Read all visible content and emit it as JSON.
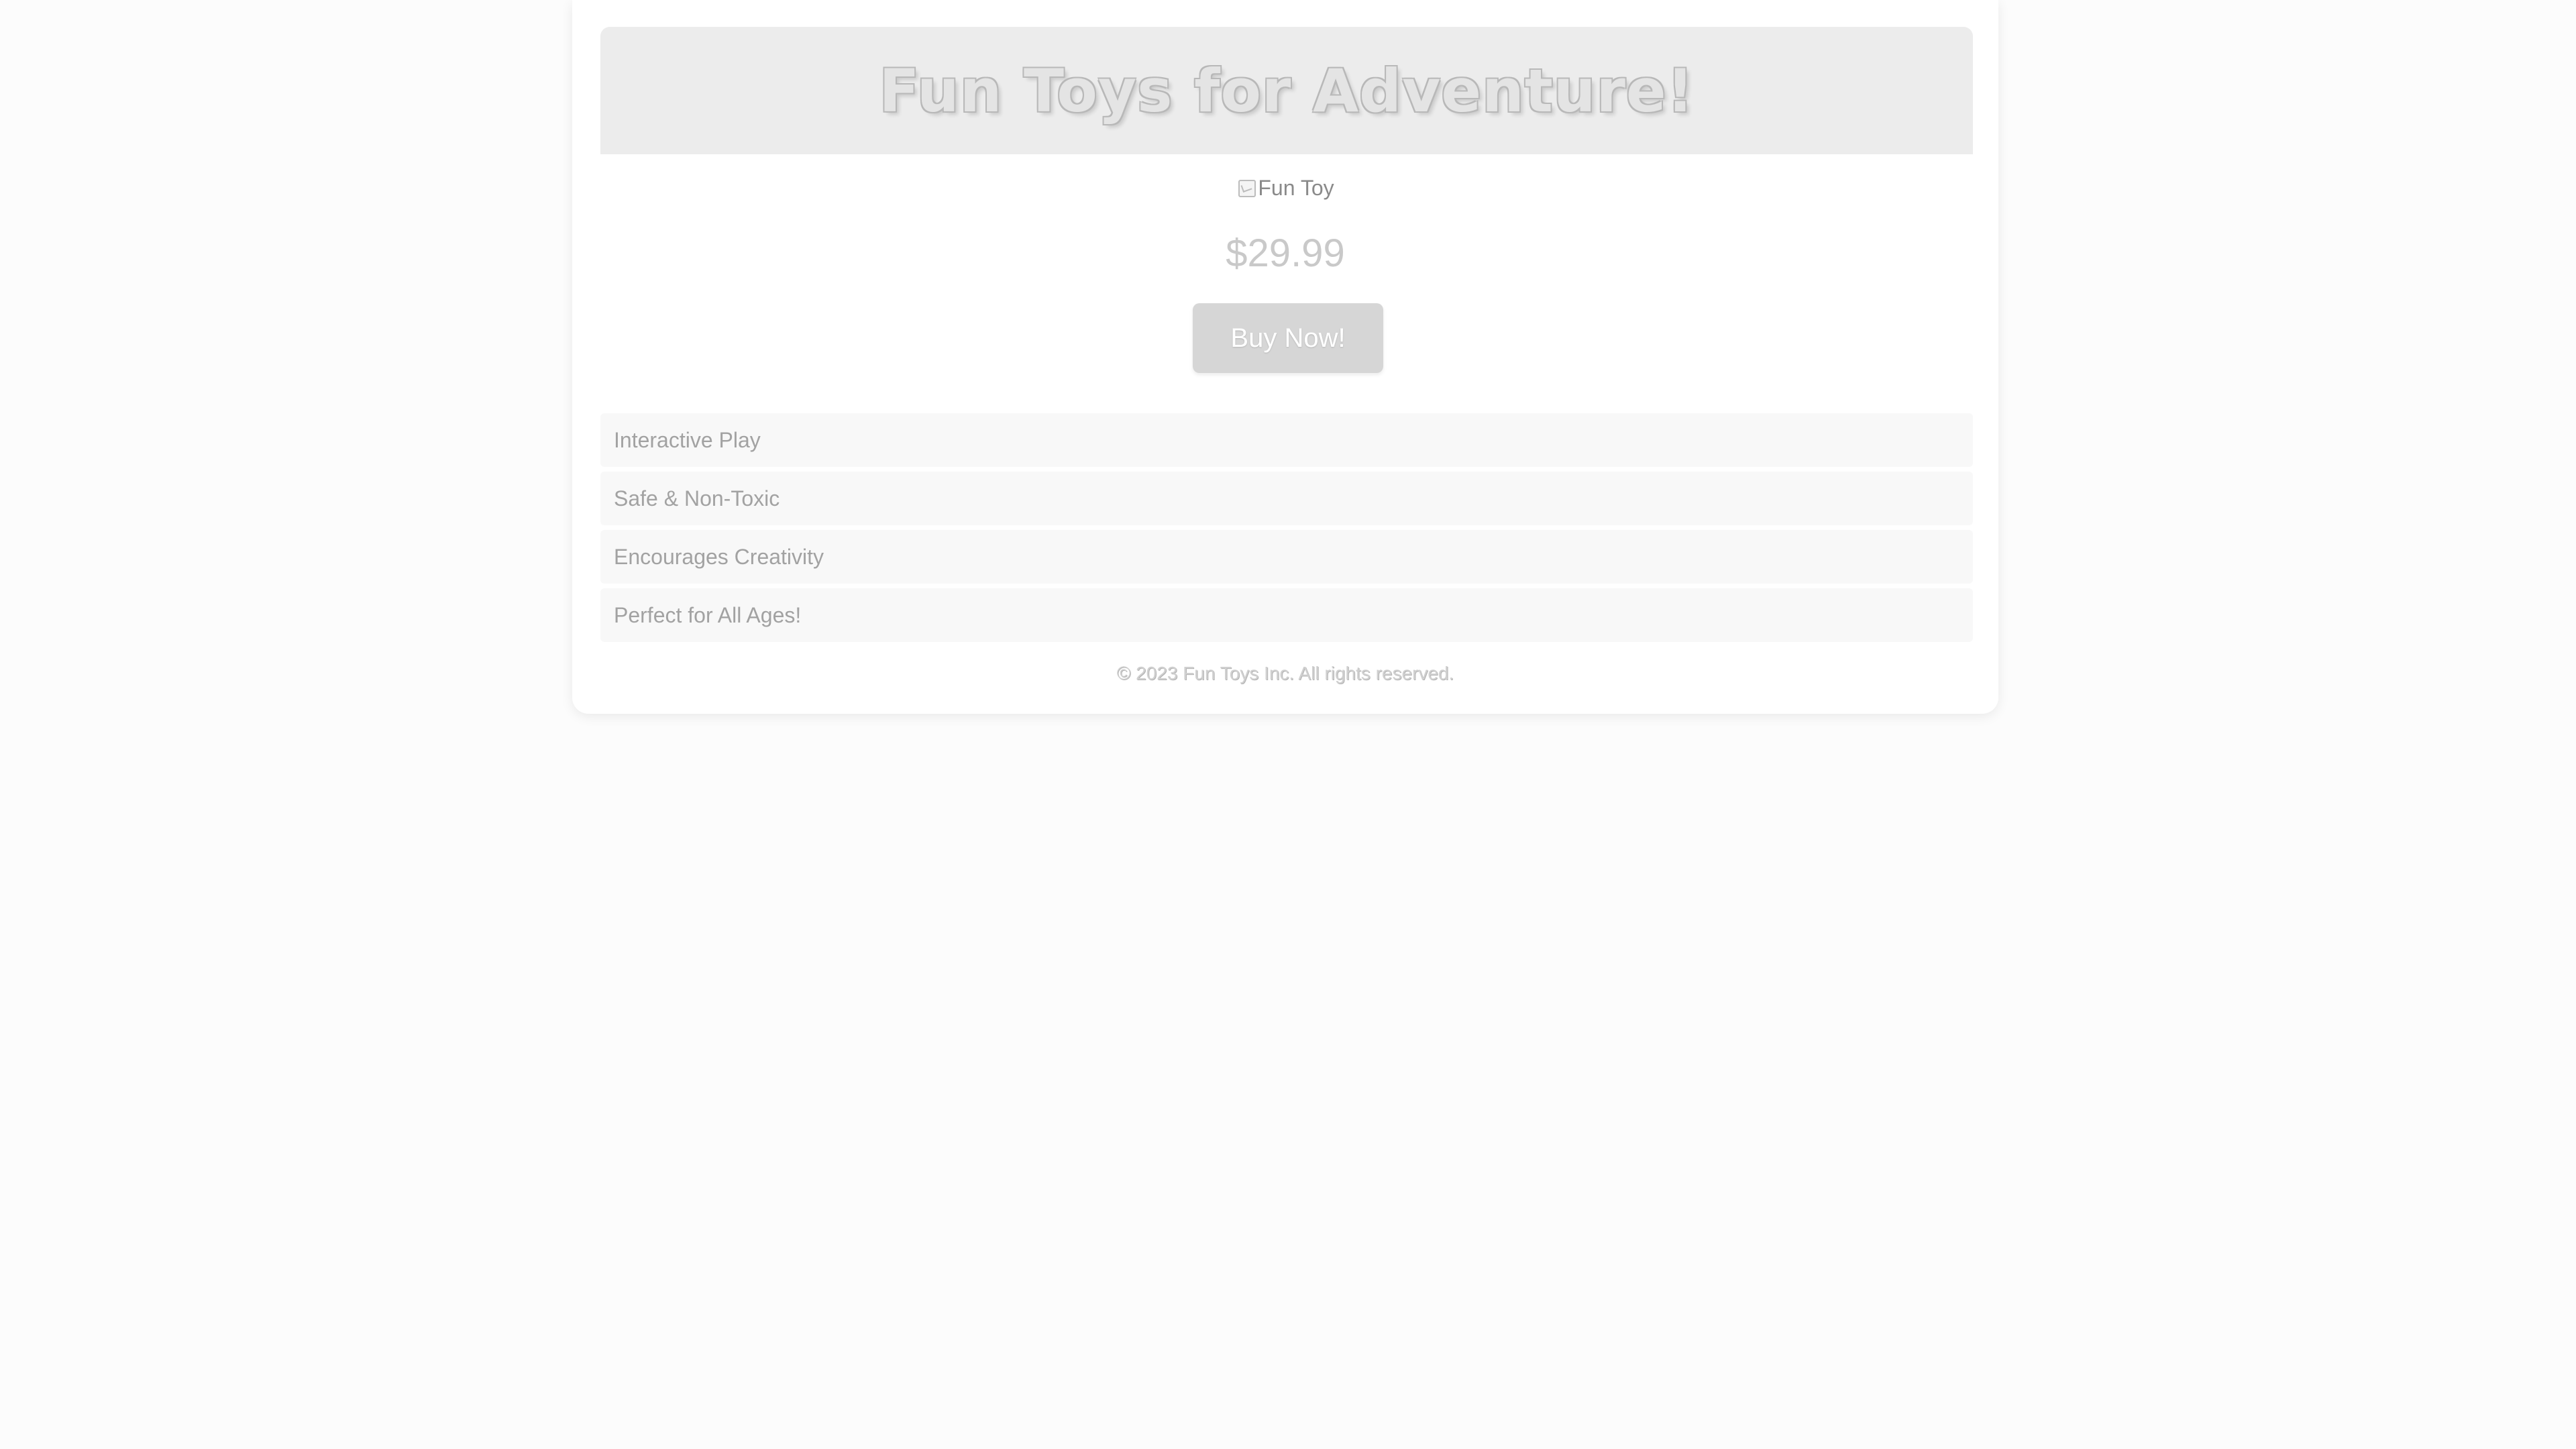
{
  "header": {
    "title": "Fun Toys for Adventure!"
  },
  "product": {
    "image_alt": "Fun Toy",
    "image_icon": "broken-image-icon",
    "price": "$29.99",
    "buy_label": "Buy Now!"
  },
  "features": [
    "Interactive Play",
    "Safe & Non-Toxic",
    "Encourages Creativity",
    "Perfect for All Ages!"
  ],
  "footer": {
    "text": "© 2023 Fun Toys Inc. All rights reserved."
  },
  "colors": {
    "page_background": "#fcfcfc",
    "header_background": "#ececec",
    "button_background": "#d6d6d6",
    "feature_background": "#f8f8f8"
  }
}
